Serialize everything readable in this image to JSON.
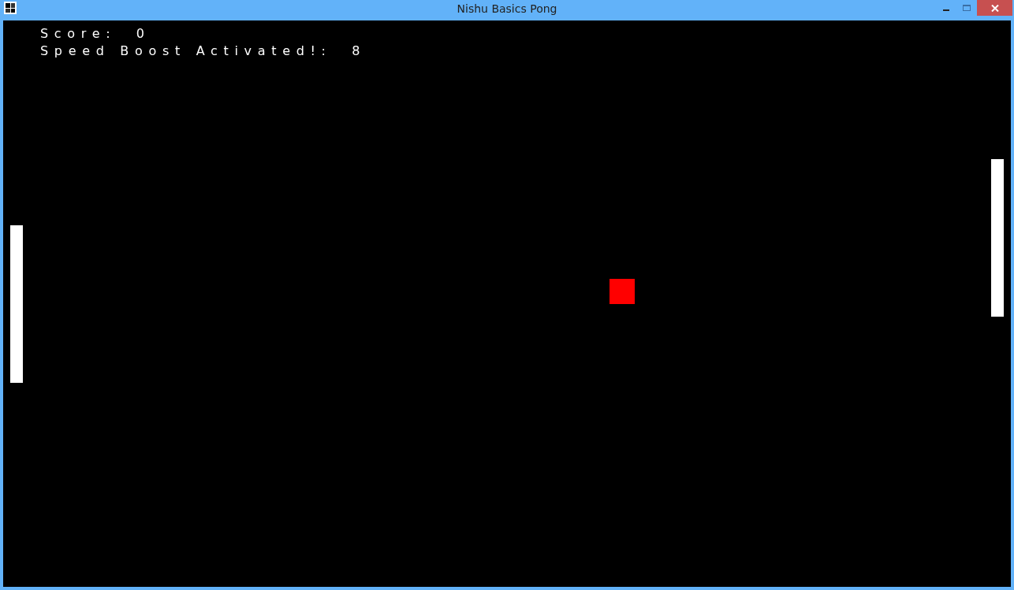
{
  "window": {
    "title": "Nishu Basics Pong"
  },
  "hud": [
    "Score:  0",
    "Speed Boost Activated!:  8"
  ]
}
